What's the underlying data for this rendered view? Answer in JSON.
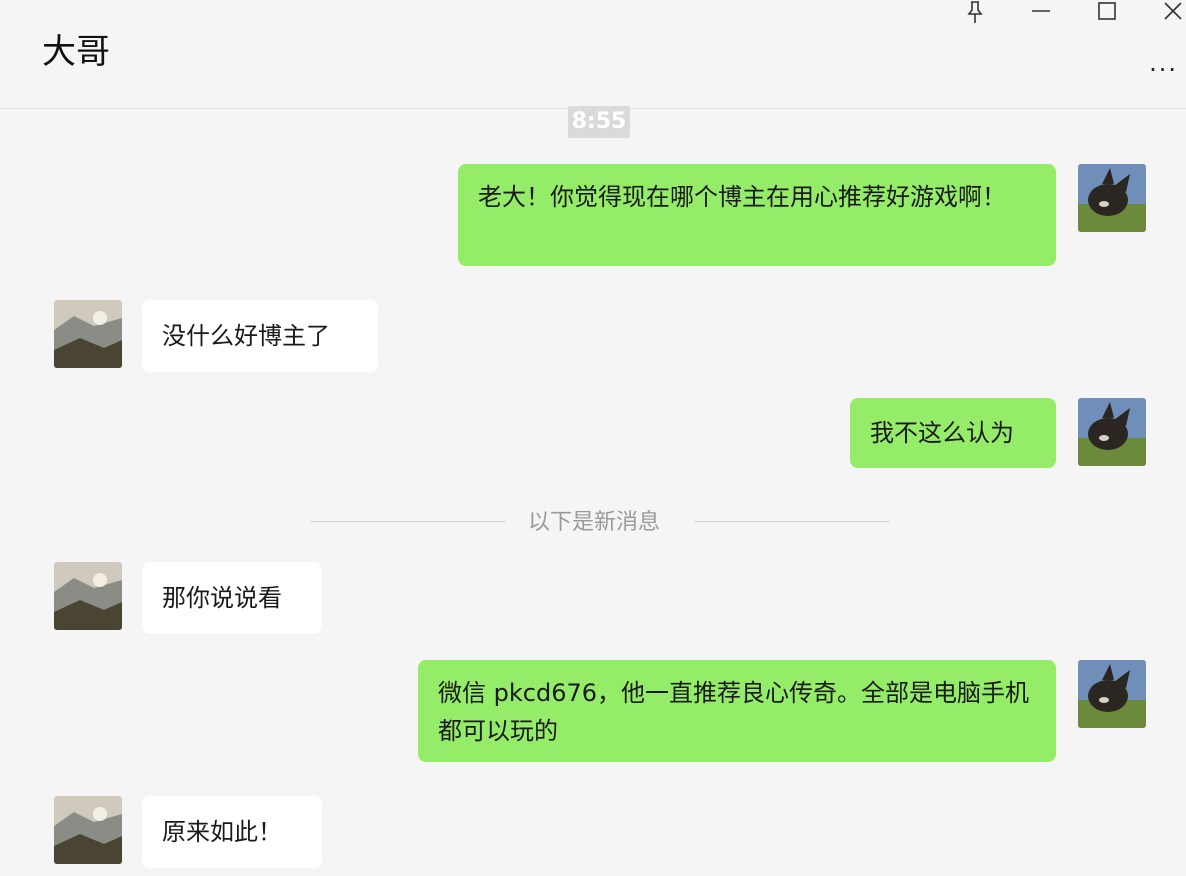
{
  "window": {
    "title": "大哥",
    "more_label": "···"
  },
  "chat": {
    "timestamp": "8:55",
    "divider_text": "以下是新消息",
    "messages": [
      {
        "from": "me",
        "text": "老大！你觉得现在哪个博主在用心推荐好游戏啊！"
      },
      {
        "from": "them",
        "text": "没什么好博主了"
      },
      {
        "from": "me",
        "text": "我不这么认为"
      },
      {
        "from": "them",
        "text": "那你说说看"
      },
      {
        "from": "me",
        "text": "微信 pkcd676，他一直推荐良心传奇。全部是电脑手机都可以玩的"
      },
      {
        "from": "them",
        "text": "原来如此！"
      }
    ]
  },
  "colors": {
    "my_bubble": "#95ec69",
    "their_bubble": "#ffffff",
    "background": "#f5f5f5"
  },
  "icons": [
    "pin-icon",
    "minimize-icon",
    "maximize-icon",
    "close-icon",
    "more-icon"
  ]
}
